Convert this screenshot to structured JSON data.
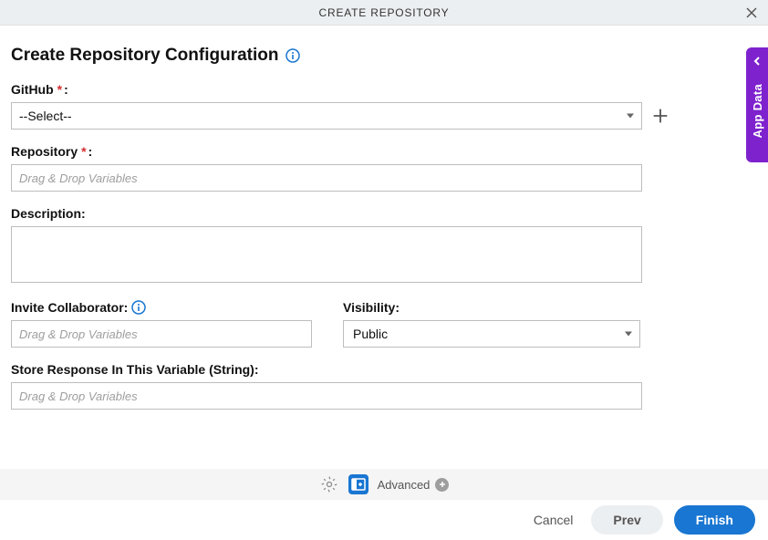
{
  "header": {
    "title": "CREATE REPOSITORY"
  },
  "page": {
    "title": "Create Repository Configuration"
  },
  "fields": {
    "github": {
      "label": "GitHub",
      "required_marker": "*",
      "colon": ":",
      "selected": "--Select--"
    },
    "repository": {
      "label": "Repository",
      "required_marker": "*",
      "colon": ":",
      "placeholder": "Drag & Drop Variables"
    },
    "description": {
      "label": "Description:",
      "value": ""
    },
    "invite": {
      "label": "Invite Collaborator:",
      "placeholder": "Drag & Drop Variables"
    },
    "visibility": {
      "label": "Visibility:",
      "selected": "Public"
    },
    "store_response": {
      "label": "Store Response In This Variable (String):",
      "placeholder": "Drag & Drop Variables"
    }
  },
  "midbar": {
    "advanced_label": "Advanced"
  },
  "footer": {
    "cancel": "Cancel",
    "prev": "Prev",
    "finish": "Finish"
  },
  "side_panel": {
    "label": "App Data"
  }
}
